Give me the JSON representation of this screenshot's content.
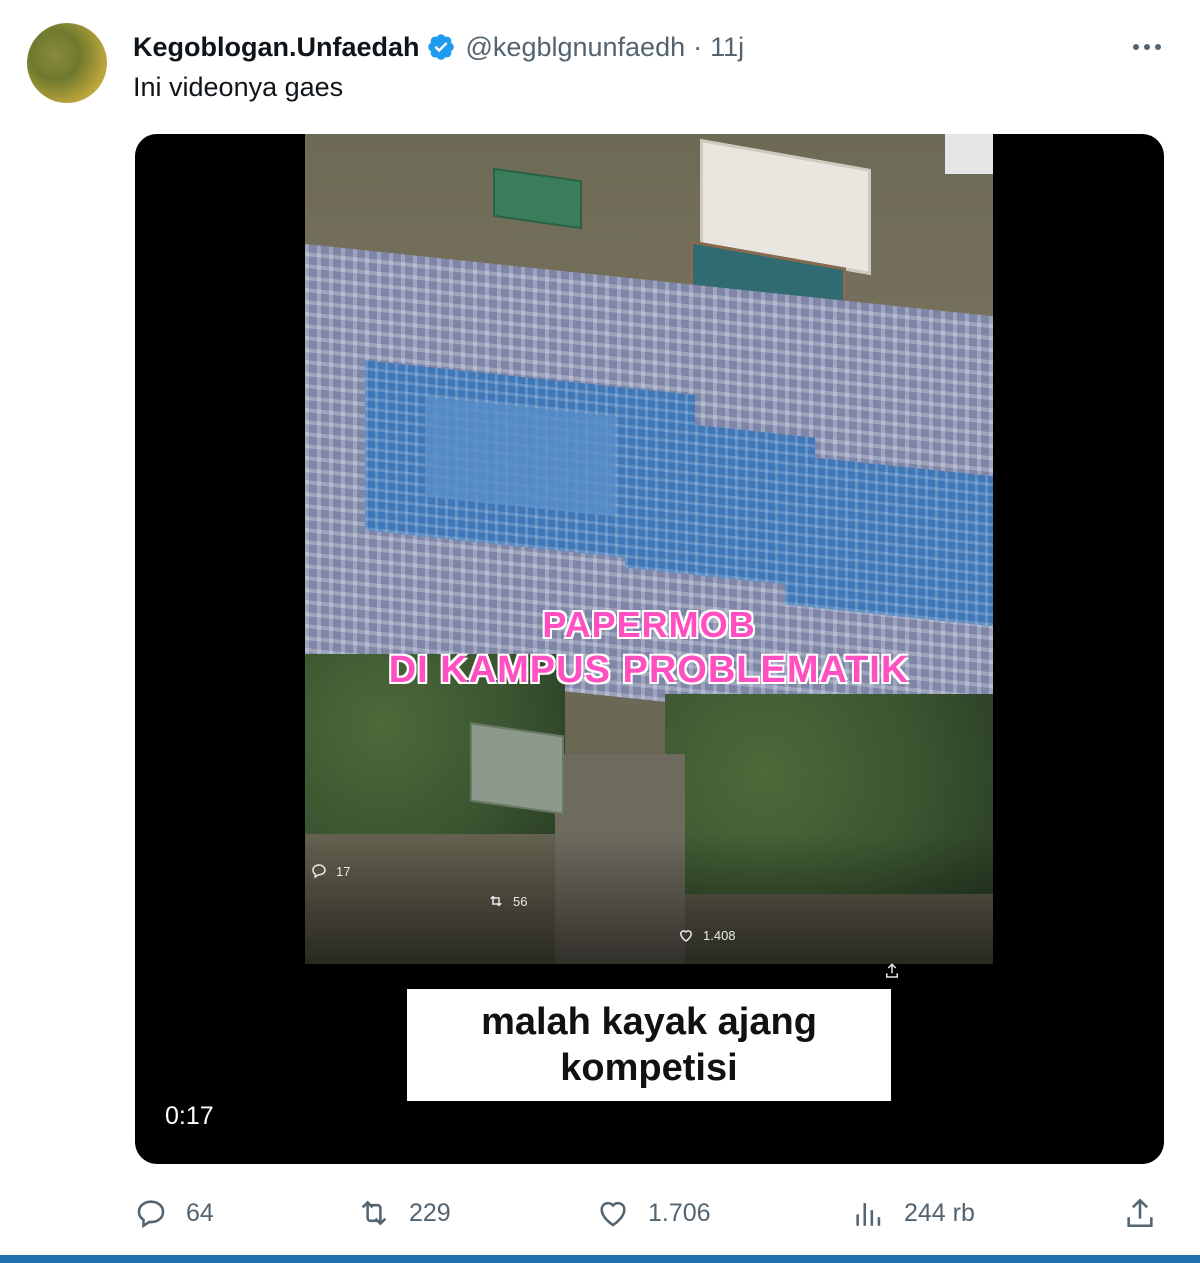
{
  "tweet": {
    "display_name": "Kegoblogan.Unfaedah",
    "handle": "@kegblgnunfaedh",
    "separator": "·",
    "time": "11j",
    "text": "Ini videonya gaes"
  },
  "video": {
    "overlay_title_line1": "PAPERMOB",
    "overlay_title_line2": "DI KAMPUS PROBLEMATIK",
    "caption_line1": "malah kayak ajang",
    "caption_line2": "kompetisi",
    "duration": "0:17",
    "embedded_stats": {
      "replies": "17",
      "retweets": "56",
      "likes": "1.408"
    }
  },
  "actions": {
    "replies": "64",
    "retweets": "229",
    "likes": "1.706",
    "views": "244 rb"
  },
  "colors": {
    "verified": "#1d9bf0",
    "overlay_title": "#ff4fc0",
    "muted": "#536471"
  },
  "icons": [
    "verified-badge-icon",
    "more-icon",
    "reply-icon",
    "retweet-icon",
    "like-icon",
    "views-icon",
    "share-icon"
  ]
}
